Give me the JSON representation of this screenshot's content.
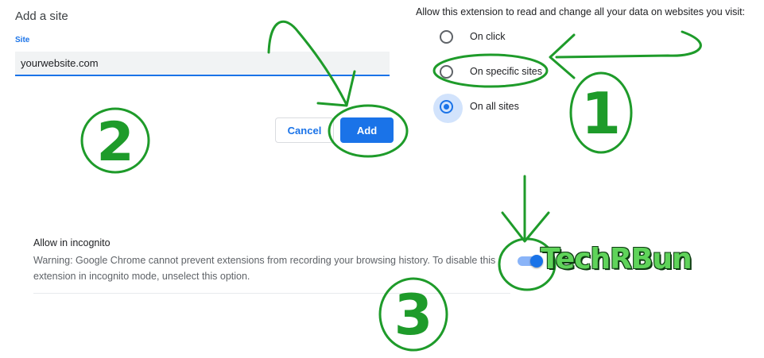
{
  "dialog": {
    "title": "Add a site",
    "site_label": "Site",
    "site_value": "yourwebsite.com",
    "cancel_label": "Cancel",
    "add_label": "Add"
  },
  "site_access": {
    "heading": "Allow this extension to read and change all your data on websites you visit:",
    "options": [
      {
        "label": "On click",
        "selected": false
      },
      {
        "label": "On specific sites",
        "selected": false
      },
      {
        "label": "On all sites",
        "selected": true
      }
    ]
  },
  "incognito": {
    "title": "Allow in incognito",
    "warning": "Warning: Google Chrome cannot prevent extensions from recording your browsing history. To disable this extension in incognito mode, unselect this option.",
    "enabled": true
  },
  "annotations": {
    "step1": "1",
    "step2": "2",
    "step3": "3",
    "watermark": "TechRBun",
    "color": "#1e9b2a"
  },
  "colors": {
    "accent": "#1a73e8",
    "annotation": "#1e9b2a"
  }
}
